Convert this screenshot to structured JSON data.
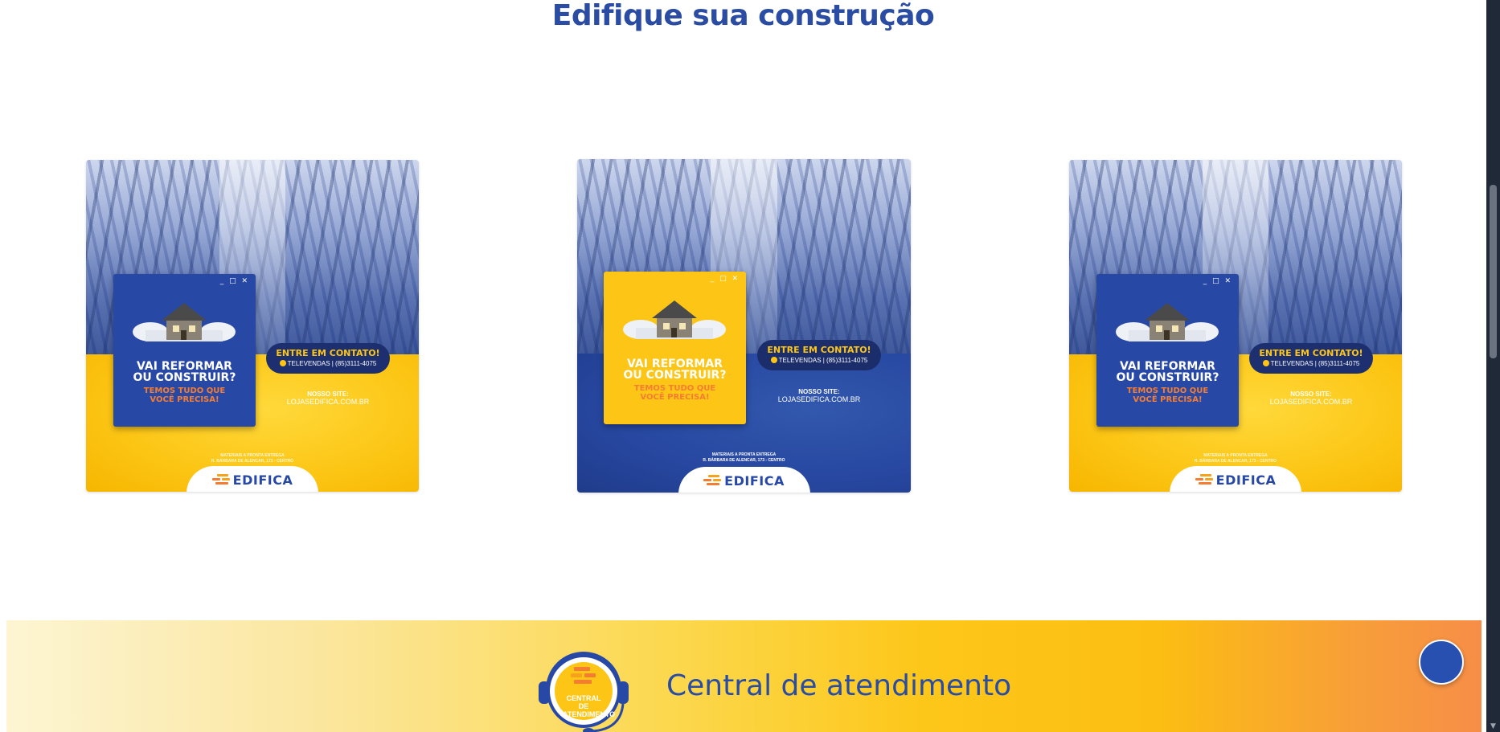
{
  "section": {
    "title": "Edifique sua construção"
  },
  "banners": [
    {
      "theme": "yellow",
      "headline_1": "VAI REFORMAR",
      "headline_2": "OU CONSTRUIR?",
      "sub_1": "TEMOS TUDO QUE",
      "sub_2": "VOCÊ PRECISA!",
      "contact_title": "ENTRE EM CONTATO!",
      "contact_phone": "TELEVENDAS | (85)3111-4075",
      "site_label": "NOSSO SITE:",
      "site_url": "LOJASEDIFICA.COM.BR",
      "address_1": "MATERIAIS A PRONTA ENTREGA",
      "address_2": "R. BÁRBARA DE ALENCAR, 173 - CENTRO",
      "logo": "EDIFICA",
      "window_controls": "_ □ ✕"
    },
    {
      "theme": "blue",
      "headline_1": "VAI REFORMAR",
      "headline_2": "OU CONSTRUIR?",
      "sub_1": "TEMOS TUDO QUE",
      "sub_2": "VOCÊ PRECISA!",
      "contact_title": "ENTRE EM CONTATO!",
      "contact_phone": "TELEVENDAS | (85)3111-4075",
      "site_label": "NOSSO SITE:",
      "site_url": "LOJASEDIFICA.COM.BR",
      "address_1": "MATERIAIS A PRONTA ENTREGA",
      "address_2": "R. BÁRBARA DE ALENCAR, 173 - CENTRO",
      "logo": "EDIFICA",
      "window_controls": "_ □ ✕"
    },
    {
      "theme": "yellow",
      "headline_1": "VAI REFORMAR",
      "headline_2": "OU CONSTRUIR?",
      "sub_1": "TEMOS TUDO QUE",
      "sub_2": "VOCÊ PRECISA!",
      "contact_title": "ENTRE EM CONTATO!",
      "contact_phone": "TELEVENDAS | (85)3111-4075",
      "site_label": "NOSSO SITE:",
      "site_url": "LOJASEDIFICA.COM.BR",
      "address_1": "MATERIAIS A PRONTA ENTREGA",
      "address_2": "R. BÁRBARA DE ALENCAR, 173 - CENTRO",
      "logo": "EDIFICA",
      "window_controls": "_ □ ✕"
    }
  ],
  "support": {
    "title": "Central de atendimento",
    "badge_line_1": "CENTRAL DE",
    "badge_line_2": "ATENDIMENTO"
  },
  "chat_button": {
    "icon": "chat-icon"
  },
  "colors": {
    "brand_blue": "#2a4da3",
    "brand_yellow": "#fdc617",
    "brand_orange": "#f47d32"
  },
  "scrollbar": {
    "arrow": "▼"
  }
}
